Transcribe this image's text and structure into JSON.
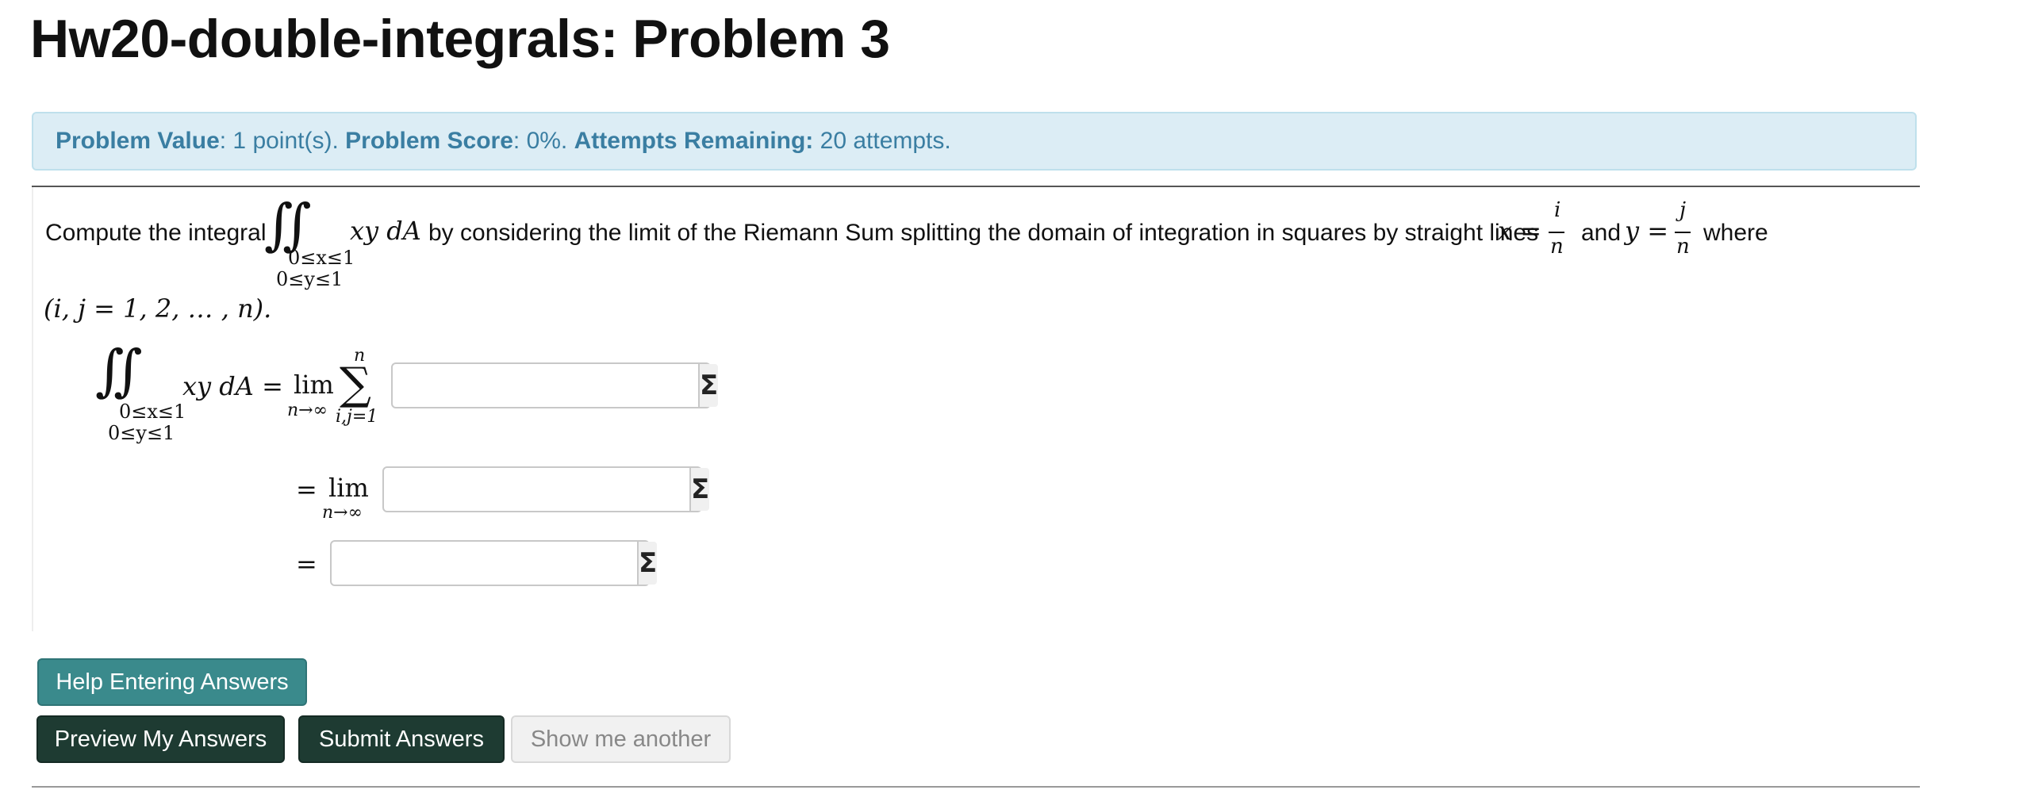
{
  "page_title": "Hw20-double-integrals: Problem 3",
  "info": {
    "value_label": "Problem Value",
    "value_text": ": 1 point(s). ",
    "score_label": "Problem Score",
    "score_text": ": 0%. ",
    "attempts_label": "Attempts Remaining:",
    "attempts_text": " 20 attempts."
  },
  "problem": {
    "intro": "Compute the integral",
    "integrand": "xy dA",
    "middle": "by considering the limit of the Riemann Sum splitting the domain of integration in squares by straight lines",
    "x_eq": "x =",
    "and": "and",
    "y_eq": "y =",
    "where": "where",
    "frac_i_num": "i",
    "frac_j_num": "j",
    "frac_den": "n",
    "bounds_x": "0≤x≤1",
    "bounds_y": "0≤y≤1",
    "index_range": "(i, j = 1, 2, … , n)."
  },
  "equations": {
    "lhs_integrand": "xy dA =",
    "lim": "lim",
    "lim_sub": "n→∞",
    "sum_top": "n",
    "sum_bottom": "i,j=1",
    "equals": "=",
    "sigma": "Σ",
    "answers": [
      "",
      "",
      ""
    ]
  },
  "buttons": {
    "help": "Help Entering Answers",
    "preview": "Preview My Answers",
    "submit": "Submit Answers",
    "another": "Show me another"
  }
}
